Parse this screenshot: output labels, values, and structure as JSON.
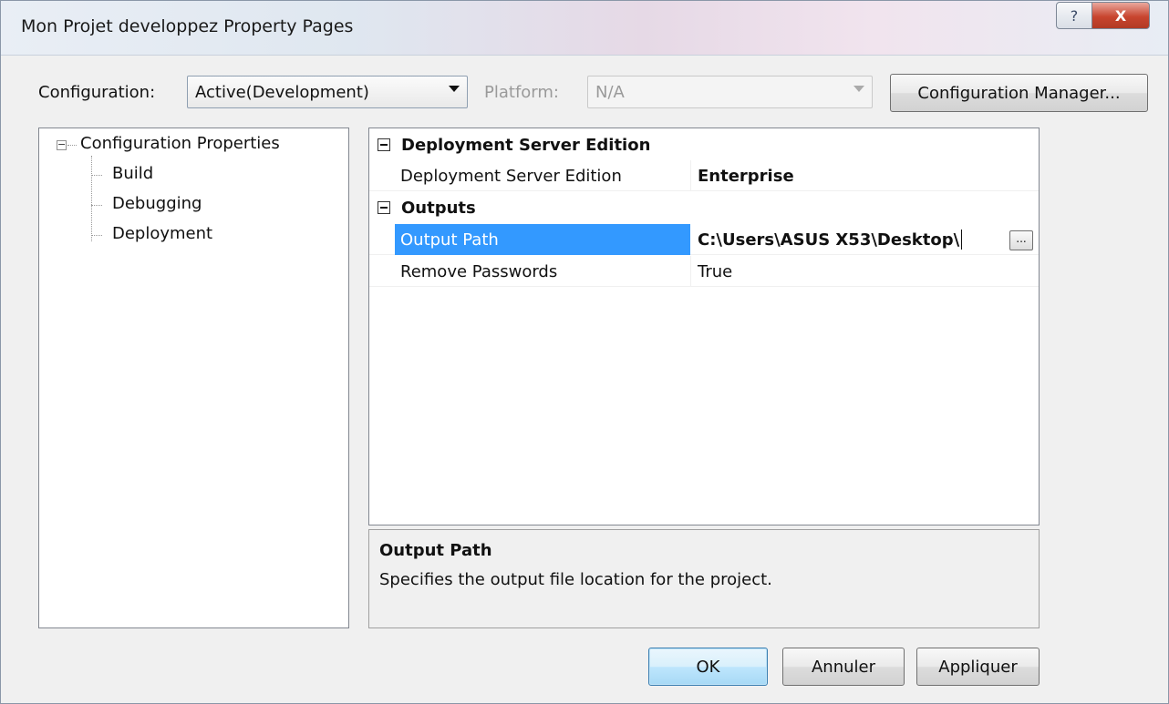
{
  "window": {
    "title": "Mon Projet developpez Property Pages",
    "help_glyph": "?",
    "close_glyph": "X"
  },
  "toolbar": {
    "configuration_label": "Configuration:",
    "configuration_value": "Active(Development)",
    "platform_label": "Platform:",
    "platform_value": "N/A",
    "configuration_manager_label": "Configuration Manager..."
  },
  "tree": {
    "root": {
      "label": "Configuration Properties",
      "expander": "−"
    },
    "children": [
      {
        "label": "Build"
      },
      {
        "label": "Debugging"
      },
      {
        "label": "Deployment"
      }
    ]
  },
  "grid": {
    "categories": [
      {
        "label": "Deployment Server Edition",
        "rows": [
          {
            "name": "Deployment Server Edition",
            "value": "Enterprise"
          }
        ]
      },
      {
        "label": "Outputs",
        "rows": [
          {
            "name": "Output Path",
            "value": "C:\\Users\\ASUS X53\\Desktop\\",
            "browse_label": "..."
          },
          {
            "name": "Remove Passwords",
            "value": "True"
          }
        ]
      }
    ]
  },
  "description": {
    "title": "Output Path",
    "text": "Specifies the output file location for the project."
  },
  "buttons": {
    "ok": "OK",
    "cancel": "Annuler",
    "apply": "Appliquer"
  },
  "colors": {
    "selection": "#3399ff",
    "close_button": "#c8452f"
  }
}
